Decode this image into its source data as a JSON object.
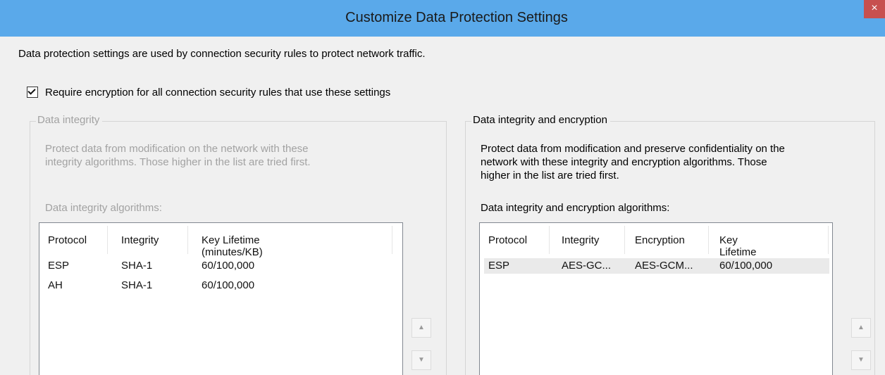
{
  "window": {
    "title": "Customize Data Protection Settings",
    "close_glyph": "×"
  },
  "description": "Data protection settings are used by connection security rules to protect network traffic.",
  "require_encryption": {
    "label": "Require encryption for all connection security rules that use these settings",
    "checked": true
  },
  "data_integrity": {
    "legend": "Data integrity",
    "description_line1": "Protect data from modification on the network with these",
    "description_line2": "integrity algorithms.  Those higher in the list are tried first.",
    "algorithms_label": "Data integrity algorithms:",
    "columns": [
      "Protocol",
      "Integrity",
      "Key Lifetime (minutes/KB)"
    ],
    "rows": [
      [
        "ESP",
        "SHA-1",
        "60/100,000"
      ],
      [
        "AH",
        "SHA-1",
        "60/100,000"
      ]
    ],
    "move_up_glyph": "▲",
    "move_down_glyph": "▼"
  },
  "data_integrity_encryption": {
    "legend": "Data integrity and encryption",
    "description_line1": "Protect data from modification and preserve confidentiality on the",
    "description_line2": "network with these integrity and encryption algorithms.  Those",
    "description_line3": "higher in the list are tried first.",
    "algorithms_label": "Data integrity and encryption algorithms:",
    "columns": [
      "Protocol",
      "Integrity",
      "Encryption",
      "Key Lifetime (min..."
    ],
    "rows": [
      [
        "ESP",
        "AES-GC...",
        "AES-GCM...",
        "60/100,000"
      ]
    ],
    "move_up_glyph": "▲",
    "move_down_glyph": "▼"
  },
  "colors": {
    "titlebar": "#5aa9ea",
    "close_button": "#c7504f",
    "dialog_background": "#f0f0f0",
    "disabled_text": "#a2a2a2"
  }
}
